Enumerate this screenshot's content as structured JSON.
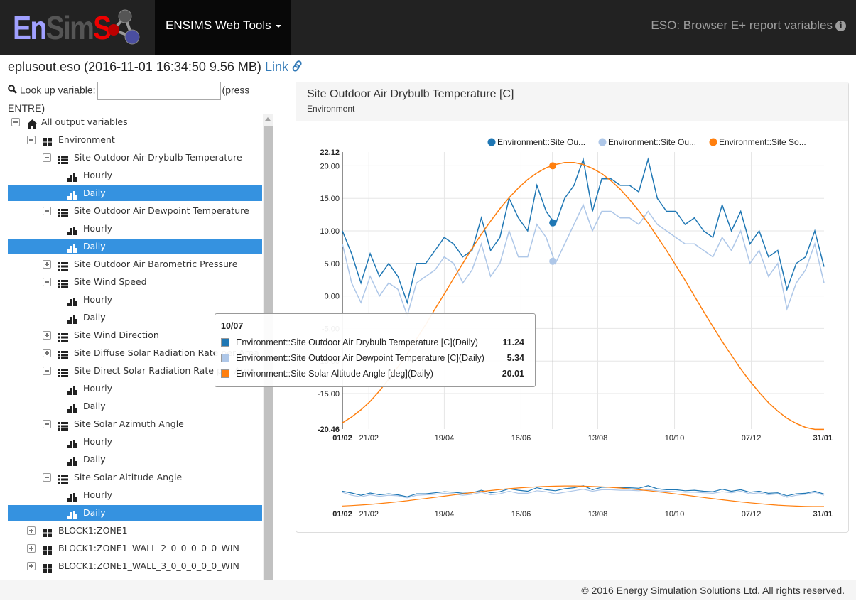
{
  "header": {
    "logo_text": "EnSimS",
    "nav_label": "ENSIMS Web Tools",
    "app_title": "ESO: Browser E+ report variables",
    "info_icon": "info-circle-icon"
  },
  "file": {
    "name": "eplusout.eso",
    "info": "(2016-11-01 16:34:50 9.56 MB)",
    "link_label": "Link",
    "link_icon": "link-icon"
  },
  "lookup": {
    "label": "Look up variable:",
    "value": "",
    "placeholder": "",
    "hint": "(press ENTRE)"
  },
  "tree": [
    {
      "level": 0,
      "toggle": "minus",
      "icon": "home",
      "label": "All output variables"
    },
    {
      "level": 1,
      "toggle": "minus",
      "icon": "grid",
      "label": "Environment"
    },
    {
      "level": 2,
      "toggle": "minus",
      "icon": "list",
      "label": "Site Outdoor Air Drybulb Temperature"
    },
    {
      "level": 3,
      "icon": "chart",
      "label": "Hourly"
    },
    {
      "level": 3,
      "icon": "chart",
      "label": "Daily",
      "selected": true
    },
    {
      "level": 2,
      "toggle": "minus",
      "icon": "list",
      "label": "Site Outdoor Air Dewpoint Temperature"
    },
    {
      "level": 3,
      "icon": "chart",
      "label": "Hourly"
    },
    {
      "level": 3,
      "icon": "chart",
      "label": "Daily",
      "selected": true
    },
    {
      "level": 2,
      "toggle": "plus",
      "icon": "list",
      "label": "Site Outdoor Air Barometric Pressure"
    },
    {
      "level": 2,
      "toggle": "minus",
      "icon": "list",
      "label": "Site Wind Speed"
    },
    {
      "level": 3,
      "icon": "chart",
      "label": "Hourly"
    },
    {
      "level": 3,
      "icon": "chart",
      "label": "Daily"
    },
    {
      "level": 2,
      "toggle": "plus",
      "icon": "list",
      "label": "Site Wind Direction"
    },
    {
      "level": 2,
      "toggle": "plus",
      "icon": "list",
      "label": "Site Diffuse Solar Radiation Rate per Area"
    },
    {
      "level": 2,
      "toggle": "minus",
      "icon": "list",
      "label": "Site Direct Solar Radiation Rate per Area"
    },
    {
      "level": 3,
      "icon": "chart",
      "label": "Hourly"
    },
    {
      "level": 3,
      "icon": "chart",
      "label": "Daily"
    },
    {
      "level": 2,
      "toggle": "minus",
      "icon": "list",
      "label": "Site Solar Azimuth Angle"
    },
    {
      "level": 3,
      "icon": "chart",
      "label": "Hourly"
    },
    {
      "level": 3,
      "icon": "chart",
      "label": "Daily"
    },
    {
      "level": 2,
      "toggle": "minus",
      "icon": "list",
      "label": "Site Solar Altitude Angle"
    },
    {
      "level": 3,
      "icon": "chart",
      "label": "Hourly"
    },
    {
      "level": 3,
      "icon": "chart",
      "label": "Daily",
      "selected": true
    },
    {
      "level": 1,
      "toggle": "plus",
      "icon": "grid",
      "label": "BLOCK1:ZONE1"
    },
    {
      "level": 1,
      "toggle": "plus",
      "icon": "grid",
      "label": "BLOCK1:ZONE1_WALL_2_0_0_0_0_0_WIN"
    },
    {
      "level": 1,
      "toggle": "plus",
      "icon": "grid",
      "label": "BLOCK1:ZONE1_WALL_3_0_0_0_0_0_WIN"
    }
  ],
  "panel": {
    "title": "Site Outdoor Air Drybulb Temperature [C]",
    "subtitle": "Environment"
  },
  "chart_data": {
    "type": "line",
    "ylim": [
      -20.46,
      22.12
    ],
    "yticks": [
      "22.12",
      "20.00",
      "15.00",
      "10.00",
      "5.00",
      "0.00",
      "-5.00",
      "-10.00",
      "-15.00",
      "-20.46"
    ],
    "xticks": [
      "01/02",
      "21/02",
      "19/04",
      "16/06",
      "13/08",
      "10/10",
      "07/12",
      "31/01"
    ],
    "grid": true,
    "legend": "top-right",
    "x": [
      "01/02",
      "08/02",
      "15/02",
      "22/02",
      "01/03",
      "08/03",
      "15/03",
      "22/03",
      "29/03",
      "05/04",
      "12/04",
      "19/04",
      "26/04",
      "03/05",
      "10/05",
      "17/05",
      "24/05",
      "31/05",
      "07/06",
      "14/06",
      "21/06",
      "28/06",
      "05/07",
      "12/07",
      "19/07",
      "26/07",
      "02/08",
      "09/08",
      "16/08",
      "23/08",
      "30/08",
      "06/09",
      "13/09",
      "20/09",
      "27/09",
      "04/10",
      "11/10",
      "18/10",
      "25/10",
      "01/11",
      "08/11",
      "15/11",
      "22/11",
      "29/11",
      "06/12",
      "13/12",
      "20/12",
      "27/12",
      "03/01",
      "10/01",
      "17/01",
      "24/01",
      "31/01"
    ],
    "series": [
      {
        "name": "Environment::Site Ou...",
        "color": "#1f77b4",
        "values": [
          10,
          6.5,
          2,
          6.5,
          3,
          5,
          3,
          -1,
          5,
          5,
          7,
          9,
          8,
          6,
          7,
          12,
          7,
          9,
          15,
          12,
          10,
          17,
          13,
          11,
          15,
          17,
          21,
          13,
          18,
          18,
          17,
          17,
          16,
          21,
          15,
          13,
          13,
          11,
          12,
          10,
          9,
          14,
          10,
          13,
          8,
          10,
          6,
          7,
          1,
          5,
          6,
          10,
          4.5
        ]
      },
      {
        "name": "Environment::Site Ou...",
        "color": "#aec7e8",
        "values": [
          8,
          2,
          -1,
          3,
          0,
          2,
          1,
          -3,
          2,
          3,
          4,
          6,
          5,
          2,
          4,
          8,
          3,
          5,
          10,
          6,
          6,
          11,
          9,
          5,
          8,
          11,
          14,
          10,
          13,
          13,
          12,
          12,
          11,
          13,
          11,
          10,
          9,
          8,
          8,
          7,
          6,
          9,
          7,
          10,
          5,
          7,
          3,
          5,
          -2,
          2,
          4,
          8,
          2
        ]
      },
      {
        "name": "Environment::Site So...",
        "color": "#ff7f0e",
        "values": [
          -19.5,
          -18.6,
          -17.5,
          -16.2,
          -14.6,
          -12.8,
          -10.9,
          -8.9,
          -6.6,
          -4.4,
          -2.0,
          0.3,
          2.7,
          5.0,
          7.3,
          9.5,
          11.5,
          13.4,
          15.1,
          16.6,
          17.9,
          18.9,
          19.7,
          20.2,
          20.5,
          20.5,
          20.2,
          19.6,
          18.8,
          17.7,
          16.4,
          14.8,
          13.1,
          11.2,
          9.1,
          7.0,
          4.7,
          2.4,
          0.0,
          -2.4,
          -4.7,
          -7.0,
          -9.1,
          -11.2,
          -13.1,
          -14.8,
          -16.4,
          -17.7,
          -18.8,
          -19.6,
          -20.2,
          -20.5,
          -20.5
        ]
      }
    ],
    "tooltip": {
      "date": "10/07",
      "rows": [
        {
          "label": "Environment::Site Outdoor Air Drybulb Temperature [C](Daily)",
          "value": "11.24",
          "color": "#1f77b4"
        },
        {
          "label": "Environment::Site Outdoor Air Dewpoint Temperature [C](Daily)",
          "value": "5.34",
          "color": "#aec7e8"
        },
        {
          "label": "Environment::Site Solar Altitude Angle [deg](Daily)",
          "value": "20.01",
          "color": "#ff7f0e"
        }
      ]
    }
  },
  "footer": {
    "copyright": "© 2016 Energy Simulation Solutions Ltd. All rights reserved."
  }
}
